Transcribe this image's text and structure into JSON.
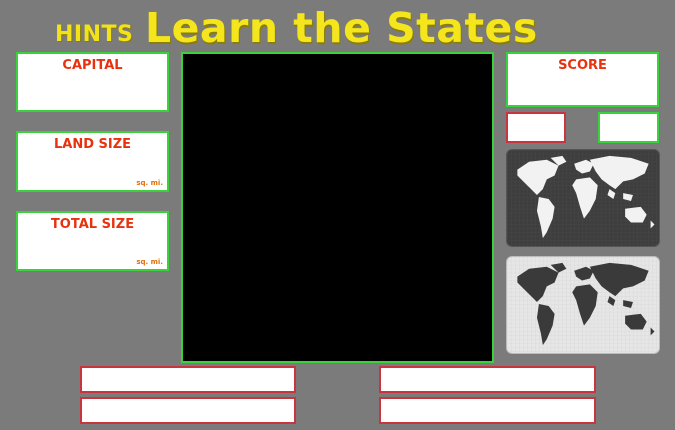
{
  "header": {
    "hints_label": "HINTS",
    "title": "Learn the States"
  },
  "hints": {
    "capital_label": "CAPITAL",
    "land_size_label": "LAND SIZE",
    "land_size_unit": "sq. mi.",
    "total_size_label": "TOTAL SIZE",
    "total_size_unit": "sq. mi."
  },
  "score": {
    "label": "SCORE"
  },
  "colors": {
    "background": "#7b7b7b",
    "title": "#f4e51c",
    "label_red": "#e8320f",
    "green_border": "#3ad23a",
    "red_border": "#c9353e"
  },
  "icons": {
    "map_dark": "world-map-dark-icon",
    "map_light": "world-map-light-icon"
  }
}
